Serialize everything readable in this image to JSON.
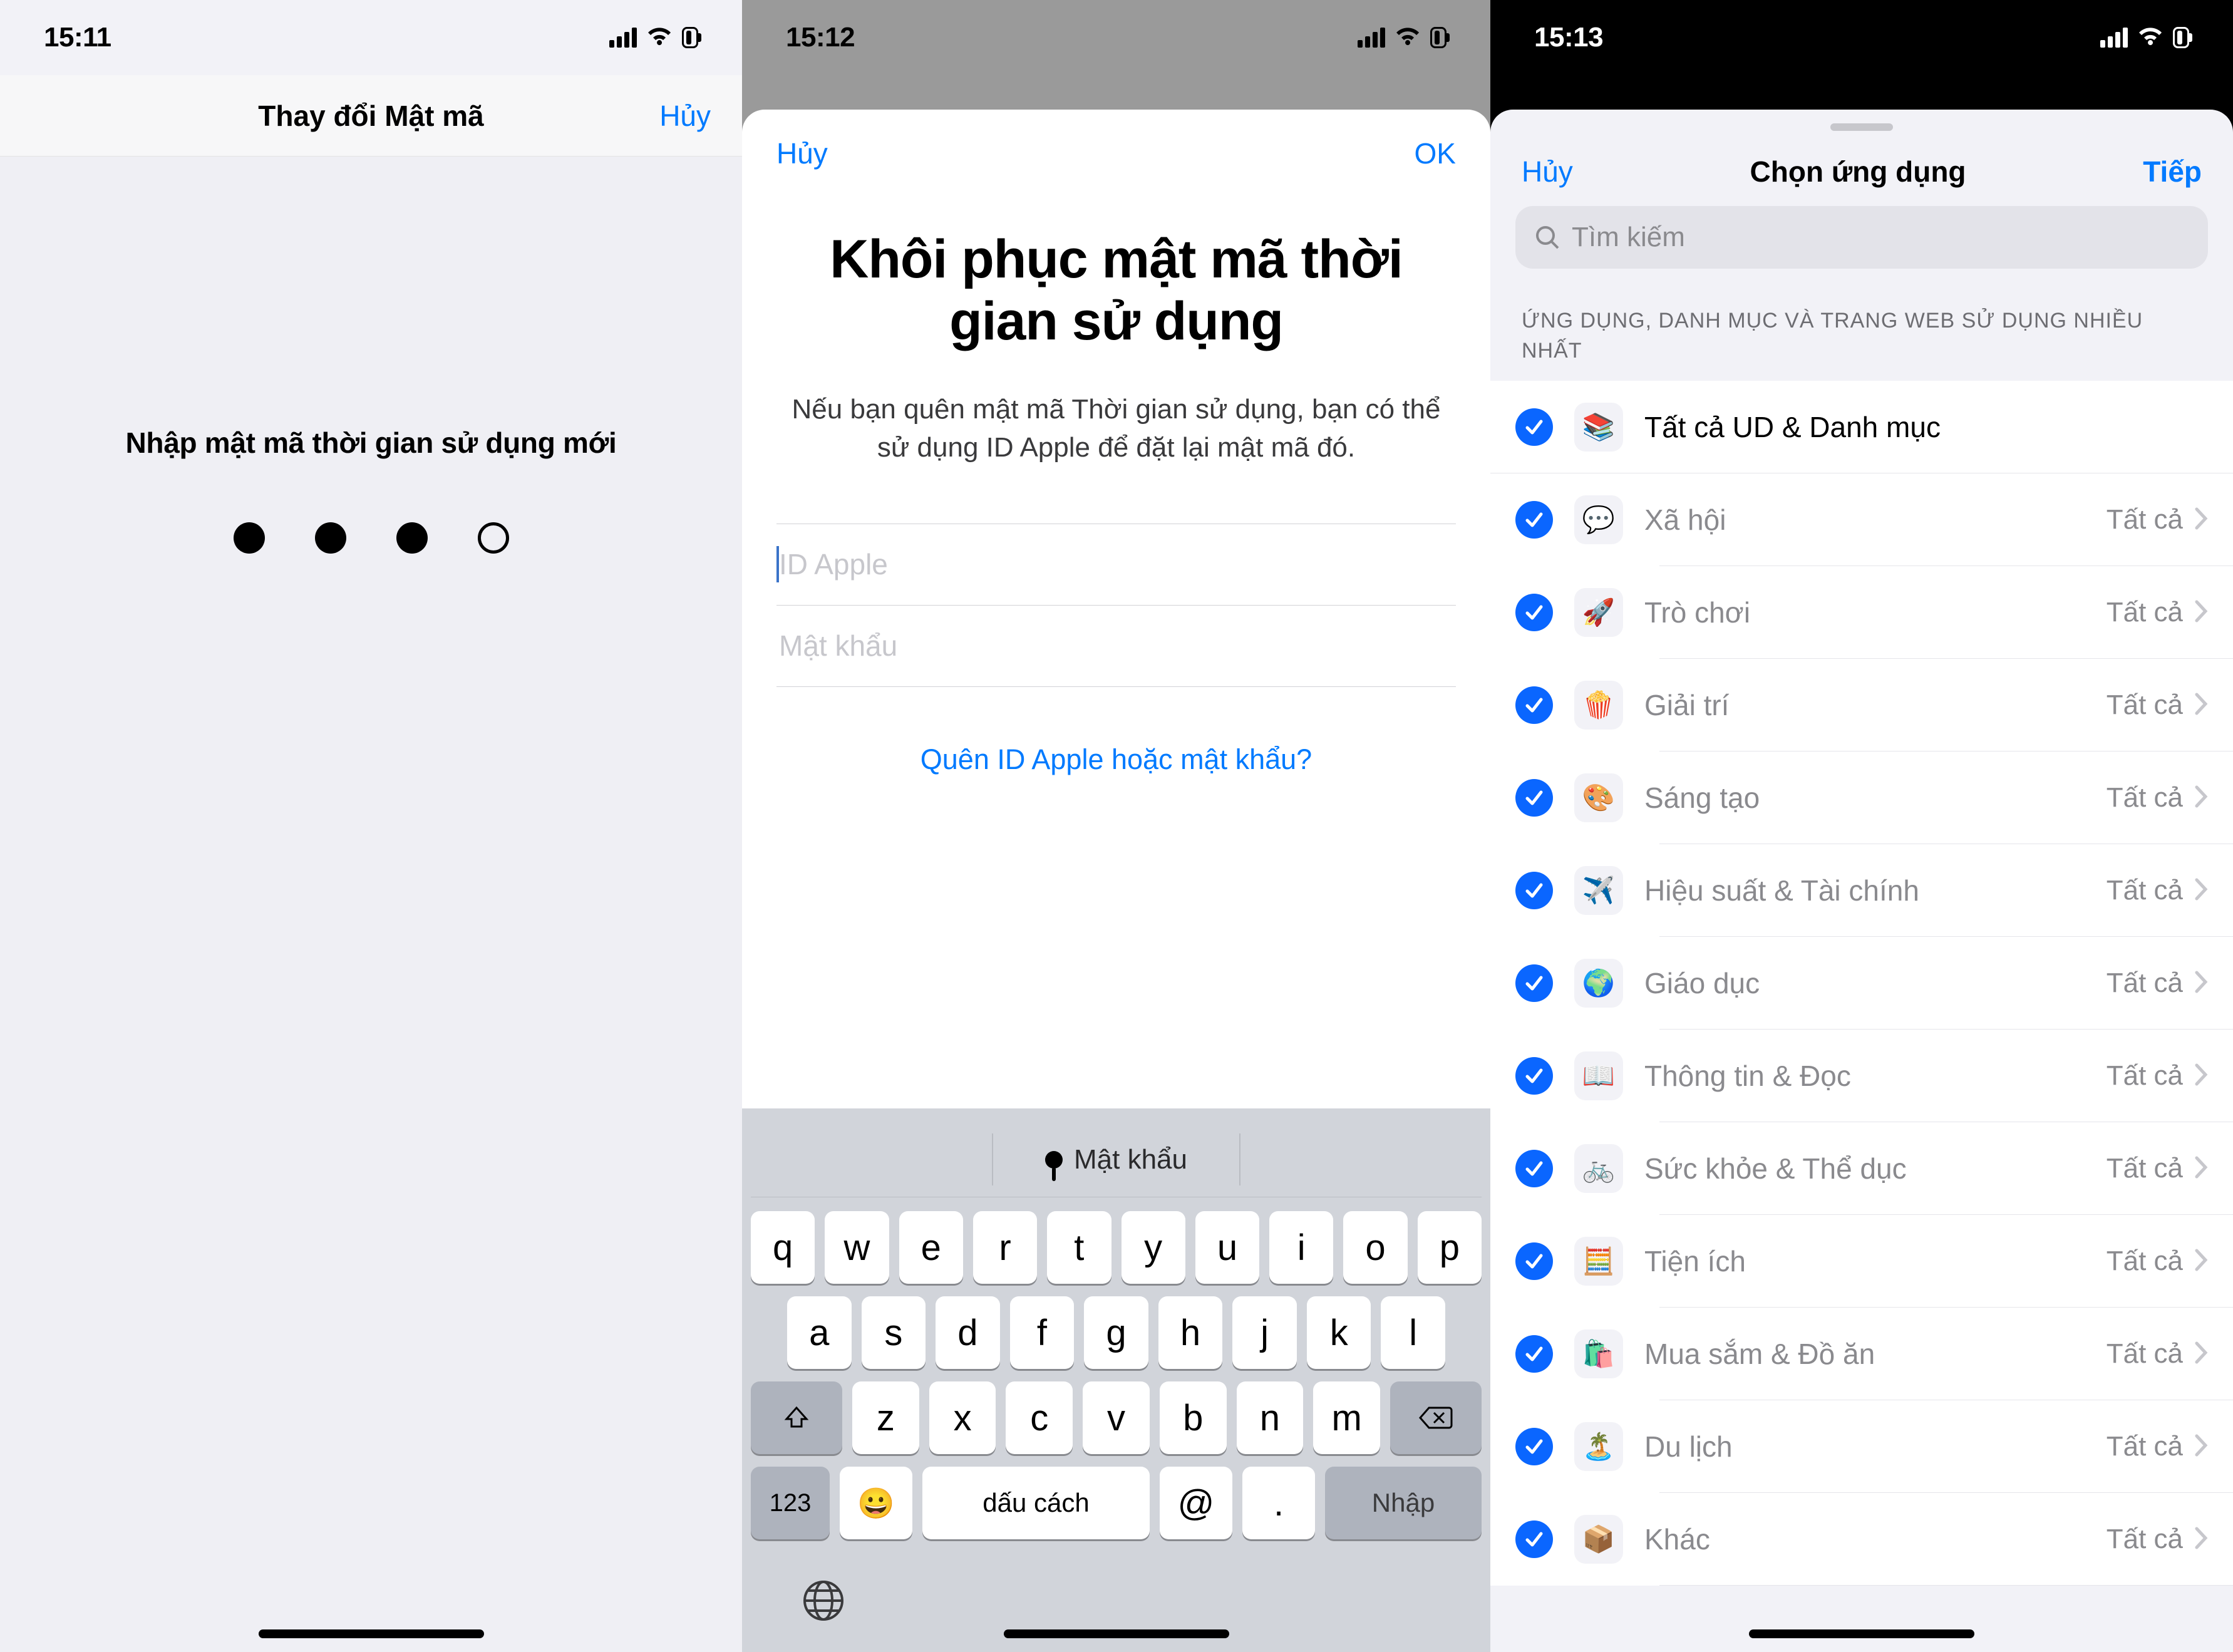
{
  "panel1": {
    "time": "15:11",
    "nav_title": "Thay đổi Mật mã",
    "nav_cancel": "Hủy",
    "prompt": "Nhập mật mã thời gian sử dụng mới",
    "dots_entered": 3
  },
  "panel2": {
    "time": "15:12",
    "nav_cancel": "Hủy",
    "nav_ok": "OK",
    "title": "Khôi phục mật mã thời gian sử dụng",
    "subtitle": "Nếu bạn quên mật mã Thời gian sử dụng, bạn có thể sử dụng ID Apple để đặt lại mật mã đó.",
    "field_apple_id": "ID Apple",
    "field_password": "Mật khẩu",
    "forgot": "Quên ID Apple hoặc mật khẩu?",
    "keyboard": {
      "suggestion": "Mật khẩu",
      "row1": [
        "q",
        "w",
        "e",
        "r",
        "t",
        "y",
        "u",
        "i",
        "o",
        "p"
      ],
      "row2": [
        "a",
        "s",
        "d",
        "f",
        "g",
        "h",
        "j",
        "k",
        "l"
      ],
      "row3": [
        "z",
        "x",
        "c",
        "v",
        "b",
        "n",
        "m"
      ],
      "num_key": "123",
      "space": "dấu cách",
      "at": "@",
      "dot": ".",
      "enter": "Nhập"
    }
  },
  "panel3": {
    "time": "15:13",
    "nav_cancel": "Hủy",
    "nav_title": "Chọn ứng dụng",
    "nav_next": "Tiếp",
    "search_placeholder": "Tìm kiếm",
    "section_header": "ỨNG DỤNG, DANH MỤC VÀ TRANG WEB SỬ DỤNG NHIỀU NHẤT",
    "all_label": "Tất cả",
    "rows": [
      {
        "icon": "📚",
        "label": "Tất cả UD & Danh mục",
        "first": true
      },
      {
        "icon": "💬",
        "label": "Xã hội"
      },
      {
        "icon": "🚀",
        "label": "Trò chơi"
      },
      {
        "icon": "🍿",
        "label": "Giải trí"
      },
      {
        "icon": "🎨",
        "label": "Sáng tạo"
      },
      {
        "icon": "✈️",
        "label": "Hiệu suất & Tài chính"
      },
      {
        "icon": "🌍",
        "label": "Giáo dục"
      },
      {
        "icon": "📖",
        "label": "Thông tin & Đọc"
      },
      {
        "icon": "🚲",
        "label": "Sức khỏe & Thể dục"
      },
      {
        "icon": "🧮",
        "label": "Tiện ích"
      },
      {
        "icon": "🛍️",
        "label": "Mua sắm & Đồ ăn"
      },
      {
        "icon": "🏝️",
        "label": "Du lịch"
      },
      {
        "icon": "📦",
        "label": "Khác"
      }
    ]
  }
}
